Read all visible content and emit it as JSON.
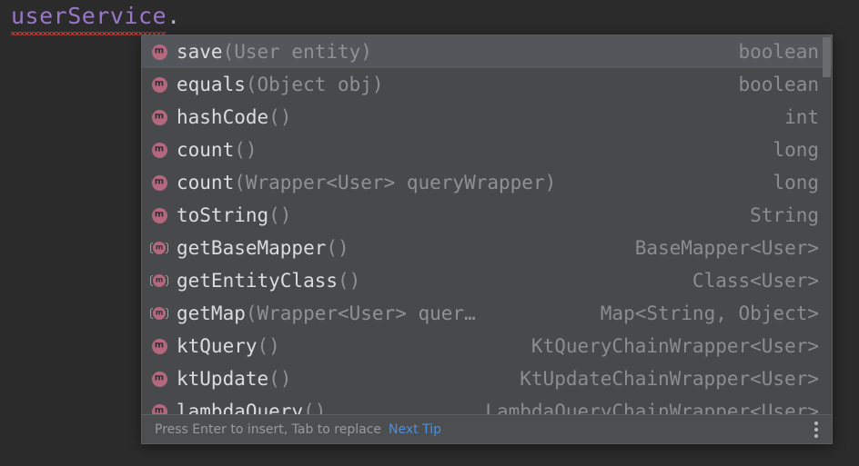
{
  "editor": {
    "code_text": "userService",
    "code_dot": ".",
    "text_color": "#9a77ca",
    "error_underline_color": "#cc3b33"
  },
  "popup": {
    "background": "#48494a",
    "selected_background": "#53565a",
    "border_color": "#5a5c5e",
    "icon_color": "#b5687d",
    "items": [
      {
        "icon": "method-icon",
        "icon_variant": "interface-method",
        "name": "save",
        "params": "(User entity)",
        "return_type": "boolean",
        "selected": true
      },
      {
        "icon": "method-icon",
        "icon_variant": "interface-method",
        "name": "equals",
        "params": "(Object obj)",
        "return_type": "boolean",
        "selected": false
      },
      {
        "icon": "method-icon",
        "icon_variant": "interface-method",
        "name": "hashCode",
        "params": "()",
        "return_type": "int",
        "selected": false
      },
      {
        "icon": "method-icon",
        "icon_variant": "interface-method",
        "name": "count",
        "params": "()",
        "return_type": "long",
        "selected": false
      },
      {
        "icon": "method-icon",
        "icon_variant": "interface-method",
        "name": "count",
        "params": "(Wrapper<User> queryWrapper)",
        "return_type": "long",
        "selected": false
      },
      {
        "icon": "method-icon",
        "icon_variant": "interface-method",
        "name": "toString",
        "params": "()",
        "return_type": "String",
        "selected": false
      },
      {
        "icon": "method-icon",
        "icon_variant": "default-method",
        "name": "getBaseMapper",
        "params": "()",
        "return_type": "BaseMapper<User>",
        "selected": false
      },
      {
        "icon": "method-icon",
        "icon_variant": "default-method",
        "name": "getEntityClass",
        "params": "()",
        "return_type": "Class<User>",
        "selected": false
      },
      {
        "icon": "method-icon",
        "icon_variant": "default-method",
        "name": "getMap",
        "params": "(Wrapper<User> quer…",
        "return_type": "Map<String, Object>",
        "selected": false
      },
      {
        "icon": "method-icon",
        "icon_variant": "interface-method",
        "name": "ktQuery",
        "params": "()",
        "return_type": "KtQueryChainWrapper<User>",
        "selected": false
      },
      {
        "icon": "method-icon",
        "icon_variant": "interface-method",
        "name": "ktUpdate",
        "params": "()",
        "return_type": "KtUpdateChainWrapper<User>",
        "selected": false
      },
      {
        "icon": "method-icon",
        "icon_variant": "interface-method",
        "name": "lambdaQuery",
        "params": "()",
        "return_type": "LambdaQueryChainWrapper<User>",
        "selected": false
      }
    ]
  },
  "footer": {
    "hint": "Press Enter to insert, Tab to replace",
    "link_label": "Next Tip",
    "link_color": "#4d90e0",
    "menu_icon": "kebab-menu-icon"
  }
}
